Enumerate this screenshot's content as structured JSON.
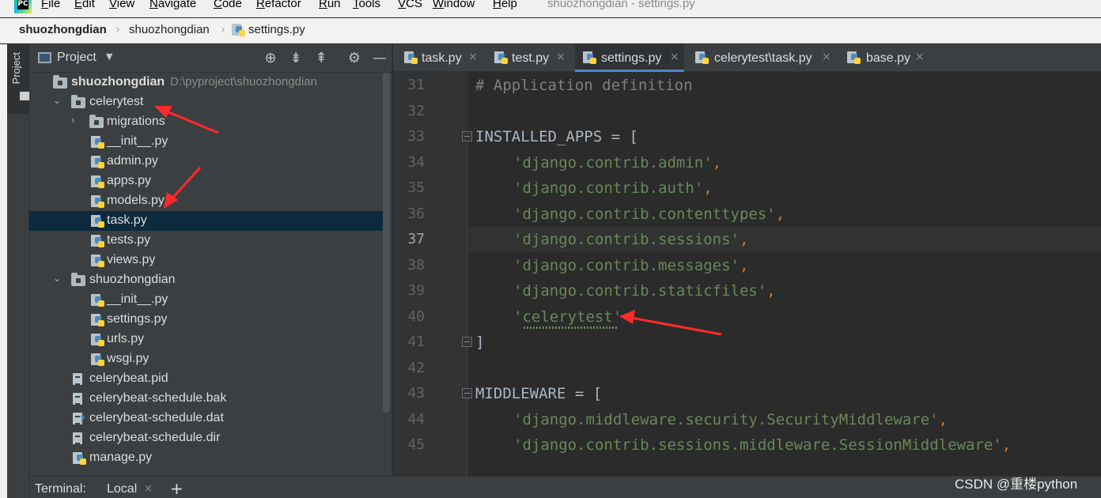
{
  "menubar": {
    "items": [
      "File",
      "Edit",
      "View",
      "Navigate",
      "Code",
      "Refactor",
      "Run",
      "Tools",
      "VCS",
      "Window",
      "Help"
    ],
    "window_title": "shuozhongdian - settings.py"
  },
  "breadcrumb": {
    "items": [
      "shuozhongdian",
      "shuozhongdian",
      "settings.py"
    ]
  },
  "left_strip": {
    "project_label": "Project"
  },
  "project_panel": {
    "title": "Project",
    "root": {
      "name": "shuozhongdian",
      "path": "D:\\pyproject\\shuozhongdian"
    },
    "tree": [
      {
        "label": "celerytest",
        "kind": "folder",
        "expanded": true
      },
      {
        "label": "migrations",
        "kind": "folder",
        "expanded": false
      },
      {
        "label": "__init__.py",
        "kind": "py"
      },
      {
        "label": "admin.py",
        "kind": "py"
      },
      {
        "label": "apps.py",
        "kind": "py"
      },
      {
        "label": "models.py",
        "kind": "py"
      },
      {
        "label": "task.py",
        "kind": "py",
        "selected": true
      },
      {
        "label": "tests.py",
        "kind": "py"
      },
      {
        "label": "views.py",
        "kind": "py"
      },
      {
        "label": "shuozhongdian",
        "kind": "folder",
        "expanded": true
      },
      {
        "label": "__init__.py",
        "kind": "py"
      },
      {
        "label": "settings.py",
        "kind": "py"
      },
      {
        "label": "urls.py",
        "kind": "py"
      },
      {
        "label": "wsgi.py",
        "kind": "py"
      },
      {
        "label": "celerybeat.pid",
        "kind": "file"
      },
      {
        "label": "celerybeat-schedule.bak",
        "kind": "file"
      },
      {
        "label": "celerybeat-schedule.dat",
        "kind": "unknown"
      },
      {
        "label": "celerybeat-schedule.dir",
        "kind": "file"
      },
      {
        "label": "manage.py",
        "kind": "py"
      }
    ]
  },
  "tabs": [
    {
      "label": "task.py",
      "active": false
    },
    {
      "label": "test.py",
      "active": false
    },
    {
      "label": "settings.py",
      "active": true
    },
    {
      "label": "celerytest\\task.py",
      "active": false
    },
    {
      "label": "base.py",
      "active": false
    }
  ],
  "editor": {
    "current_line": 37,
    "lines": [
      {
        "no": "31",
        "text": "# Application definition"
      },
      {
        "no": "32",
        "text": ""
      },
      {
        "no": "33",
        "text": "INSTALLED_APPS = ["
      },
      {
        "no": "34",
        "text": "'django.contrib.admin',"
      },
      {
        "no": "35",
        "text": "'django.contrib.auth',"
      },
      {
        "no": "36",
        "text": "'django.contrib.contenttypes',"
      },
      {
        "no": "37",
        "text": "'django.contrib.sessions',"
      },
      {
        "no": "38",
        "text": "'django.contrib.messages',"
      },
      {
        "no": "39",
        "text": "'django.contrib.staticfiles',"
      },
      {
        "no": "40",
        "text": "'celerytest'"
      },
      {
        "no": "41",
        "text": "]"
      },
      {
        "no": "42",
        "text": ""
      },
      {
        "no": "43",
        "text": "MIDDLEWARE = ["
      },
      {
        "no": "44",
        "text": "'django.middleware.security.SecurityMiddleware',"
      },
      {
        "no": "45",
        "text": "'django.contrib.sessions.middleware.SessionMiddleware',"
      }
    ]
  },
  "terminal": {
    "label": "Terminal:",
    "tab": "Local",
    "close": "×",
    "add": "+"
  },
  "watermark": "CSDN @重楼python",
  "colors": {
    "editor_bg": "#2b2b2b",
    "panel_bg": "#3c3f41",
    "selection": "#0d293e",
    "string": "#6a8759",
    "keyword_op": "#cc7832",
    "annotation": "#ff2a2a"
  }
}
